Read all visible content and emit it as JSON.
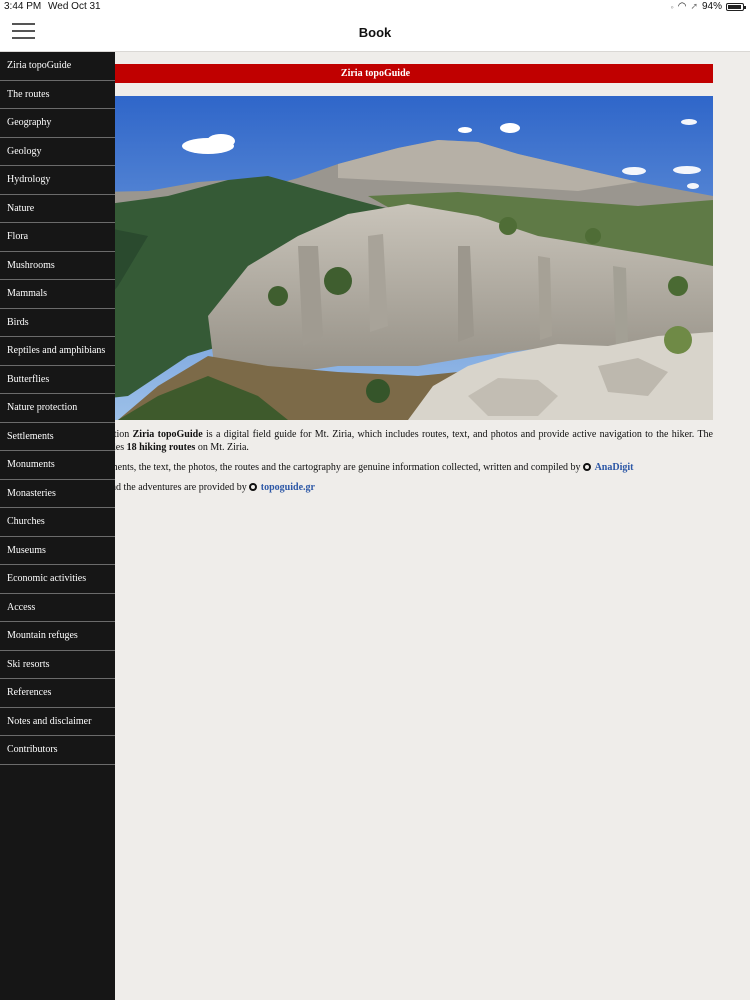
{
  "status_bar": {
    "time": "3:44 PM",
    "date": "Wed Oct 31",
    "battery_text": "94%",
    "battery_level": 0.94
  },
  "navbar": {
    "title": "Book",
    "menu_icon": "hamburger-menu-icon"
  },
  "banner": {
    "text": "Ziria topoGuide",
    "color": "#c00000"
  },
  "content": {
    "p1": {
      "prefix": "The application ",
      "bold1": "Ziria topoGuide",
      "middle": " is a digital field guide for Mt. Ziria, which includes routes, text, and photos and provide active navigation to the hiker. The digital guide includes ",
      "bold2": "18 hiking routes",
      "suffix": " on Mt. Ziria."
    },
    "p2": {
      "text": "All app elements, the text, the photos, the routes and the cartography are genuine information collected, written and compiled by",
      "link": "AnaDigit"
    },
    "p3": {
      "text": "The trails and the adventures are provided by",
      "link": "topoguide.gr"
    },
    "link_color": "#2c57a6"
  },
  "menu": {
    "items": [
      "Ziria topoGuide",
      "The routes",
      "Geography",
      "Geology",
      "Hydrology",
      "Nature",
      "Flora",
      "Mushrooms",
      "Mammals",
      "Birds",
      "Reptiles and amphibians",
      "Butterflies",
      "Nature protection",
      "Settlements",
      "Monuments",
      "Monasteries",
      "Churches",
      "Museums",
      "Economic activities",
      "Access",
      "Mountain refuges",
      "Ski resorts",
      "References",
      "Notes and disclaimer",
      "Contributors"
    ],
    "background": "#161616"
  }
}
